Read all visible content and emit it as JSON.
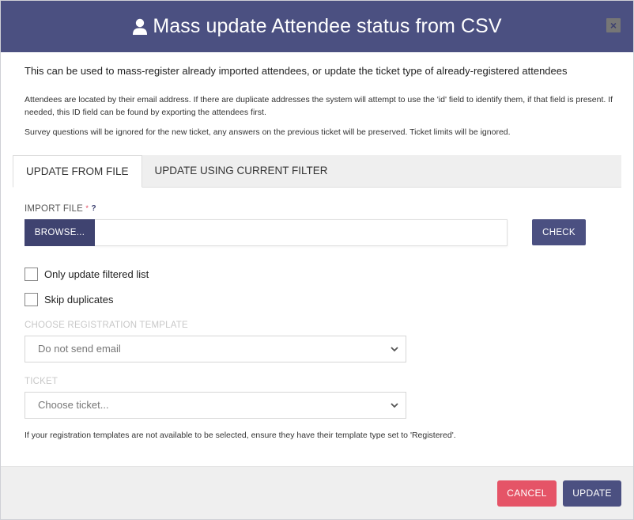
{
  "header": {
    "title": "Mass update Attendee status from CSV",
    "icon": "user-icon",
    "close_label": "×"
  },
  "body": {
    "intro": "This can be used to mass-register already imported attendees, or update the ticket type of already-registered attendees",
    "note_1": "Attendees are located by their email address. If there are duplicate addresses the system will attempt to use the 'id' field to identify them, if that field is present. If needed, this ID field can be found by exporting the attendees first.",
    "note_2": "Survey questions will be ignored for the new ticket, any answers on the previous ticket will be preserved. Ticket limits will be ignored."
  },
  "tabs": [
    {
      "label": "UPDATE FROM FILE",
      "active": true
    },
    {
      "label": "UPDATE USING CURRENT FILTER",
      "active": false
    }
  ],
  "import": {
    "label": "IMPORT FILE",
    "required_mark": "*",
    "help_mark": "?",
    "browse_label": "BROWSE...",
    "file_value": "",
    "check_label": "CHECK"
  },
  "options": {
    "only_filtered_label": "Only update filtered list",
    "only_filtered_checked": false,
    "skip_duplicates_label": "Skip duplicates",
    "skip_duplicates_checked": false
  },
  "template": {
    "label": "CHOOSE REGISTRATION TEMPLATE",
    "selected": "Do not send email"
  },
  "ticket": {
    "label": "TICKET",
    "selected": "Choose ticket..."
  },
  "footnote": "If your registration templates are not available to be selected, ensure they have their template type set to 'Registered'.",
  "footer": {
    "cancel_label": "CANCEL",
    "update_label": "UPDATE"
  },
  "colors": {
    "header_bg": "#4b5081",
    "primary": "#4b5081",
    "danger": "#e55467",
    "footer_bg": "#efefef"
  }
}
